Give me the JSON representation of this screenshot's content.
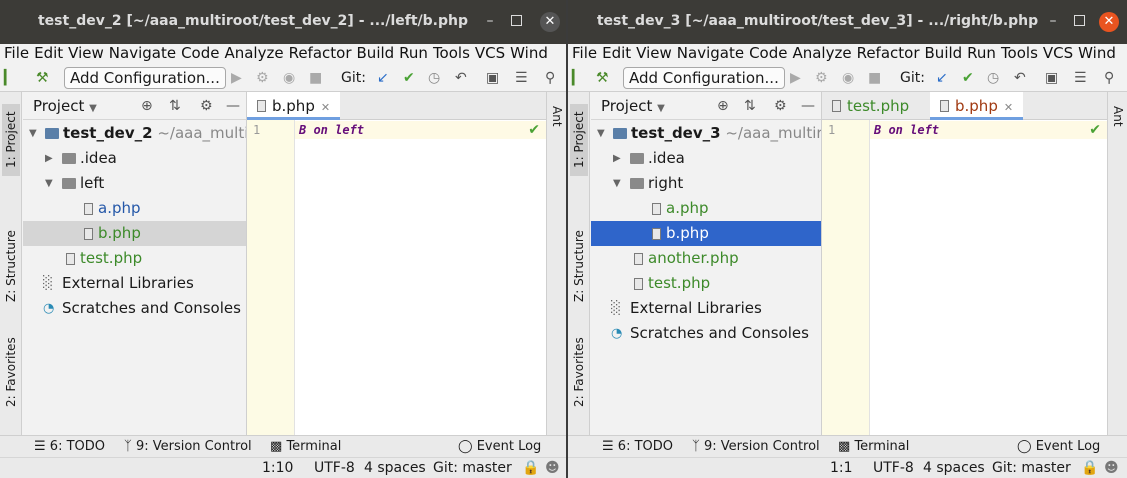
{
  "colors": {
    "titlebar": "#3c3b37",
    "close_button": "#e95420",
    "selection_blue": "#2f65ca",
    "selection_grey": "#d5d5d5",
    "php_blue": "#2457a8",
    "php_green": "#3d8a2a",
    "keyword_purple": "#660e7a",
    "ok_green": "#4aa235"
  },
  "menu": [
    "File",
    "Edit",
    "View",
    "Navigate",
    "Code",
    "Analyze",
    "Refactor",
    "Build",
    "Run",
    "Tools",
    "VCS",
    "Wind"
  ],
  "toolbar": {
    "add_config": "Add Configuration...",
    "git_label": "Git:"
  },
  "left_strip": {
    "project_tab": "1: Project",
    "structure_tab": "Z: Structure",
    "favorites_tab": "2: Favorites"
  },
  "right_strip": {
    "ant_tab": "Ant"
  },
  "project_panel": {
    "title": "Project"
  },
  "bottom_tabs": {
    "todo": "6: TODO",
    "vcs": "9: Version Control",
    "terminal": "Terminal",
    "event_log": "Event Log"
  },
  "windows": [
    {
      "title": "test_dev_2 [~/aaa_multiroot/test_dev_2] - .../left/b.php",
      "tree": {
        "root": "test_dev_2",
        "root_hint": "~/aaa_multiroot",
        "idea": ".idea",
        "folder": "left",
        "file_a": "a.php",
        "file_b": "b.php",
        "test": "test.php",
        "ext_libs": "External Libraries",
        "scratches": "Scratches and Consoles"
      },
      "tabs": [
        "b.php"
      ],
      "line_number": "1",
      "code": "B on left",
      "status": {
        "position": "1:10",
        "encoding": "UTF-8",
        "indent": "4 spaces",
        "git": "Git: master"
      }
    },
    {
      "title": "test_dev_3 [~/aaa_multiroot/test_dev_3] - .../right/b.php",
      "tree": {
        "root": "test_dev_3",
        "root_hint": "~/aaa_multiroot",
        "idea": ".idea",
        "folder": "right",
        "file_a": "a.php",
        "file_b": "b.php",
        "another": "another.php",
        "test": "test.php",
        "ext_libs": "External Libraries",
        "scratches": "Scratches and Consoles"
      },
      "tabs": [
        "test.php",
        "b.php"
      ],
      "line_number": "1",
      "code": "B on left",
      "status": {
        "position": "1:1",
        "encoding": "UTF-8",
        "indent": "4 spaces",
        "git": "Git: master"
      }
    }
  ]
}
